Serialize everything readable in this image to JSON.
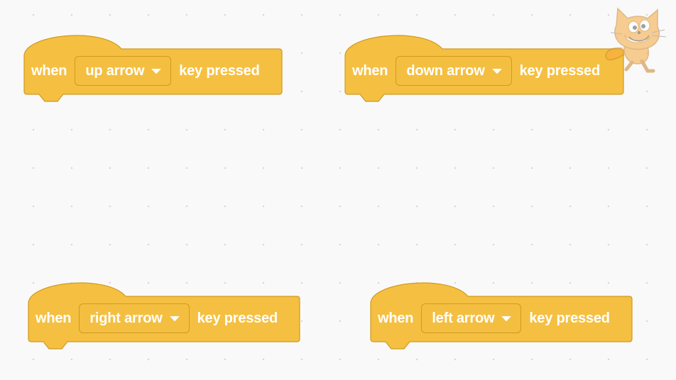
{
  "blocks": [
    {
      "when_label": "when",
      "key": "up arrow",
      "suffix": "key pressed"
    },
    {
      "when_label": "when",
      "key": "down arrow",
      "suffix": "key pressed"
    },
    {
      "when_label": "when",
      "key": "right arrow",
      "suffix": "key pressed"
    },
    {
      "when_label": "when",
      "key": "left arrow",
      "suffix": "key pressed"
    }
  ],
  "colors": {
    "block_fill": "#f5c041",
    "block_stroke": "#cf9a1f",
    "dropdown_fill": "#f4bf40",
    "workspace_bg": "#f9f9f9",
    "grid_dot": "#d6d6d6"
  },
  "icons": {
    "dropdown": "chevron-down-icon",
    "sprite": "scratch-cat-sprite"
  }
}
